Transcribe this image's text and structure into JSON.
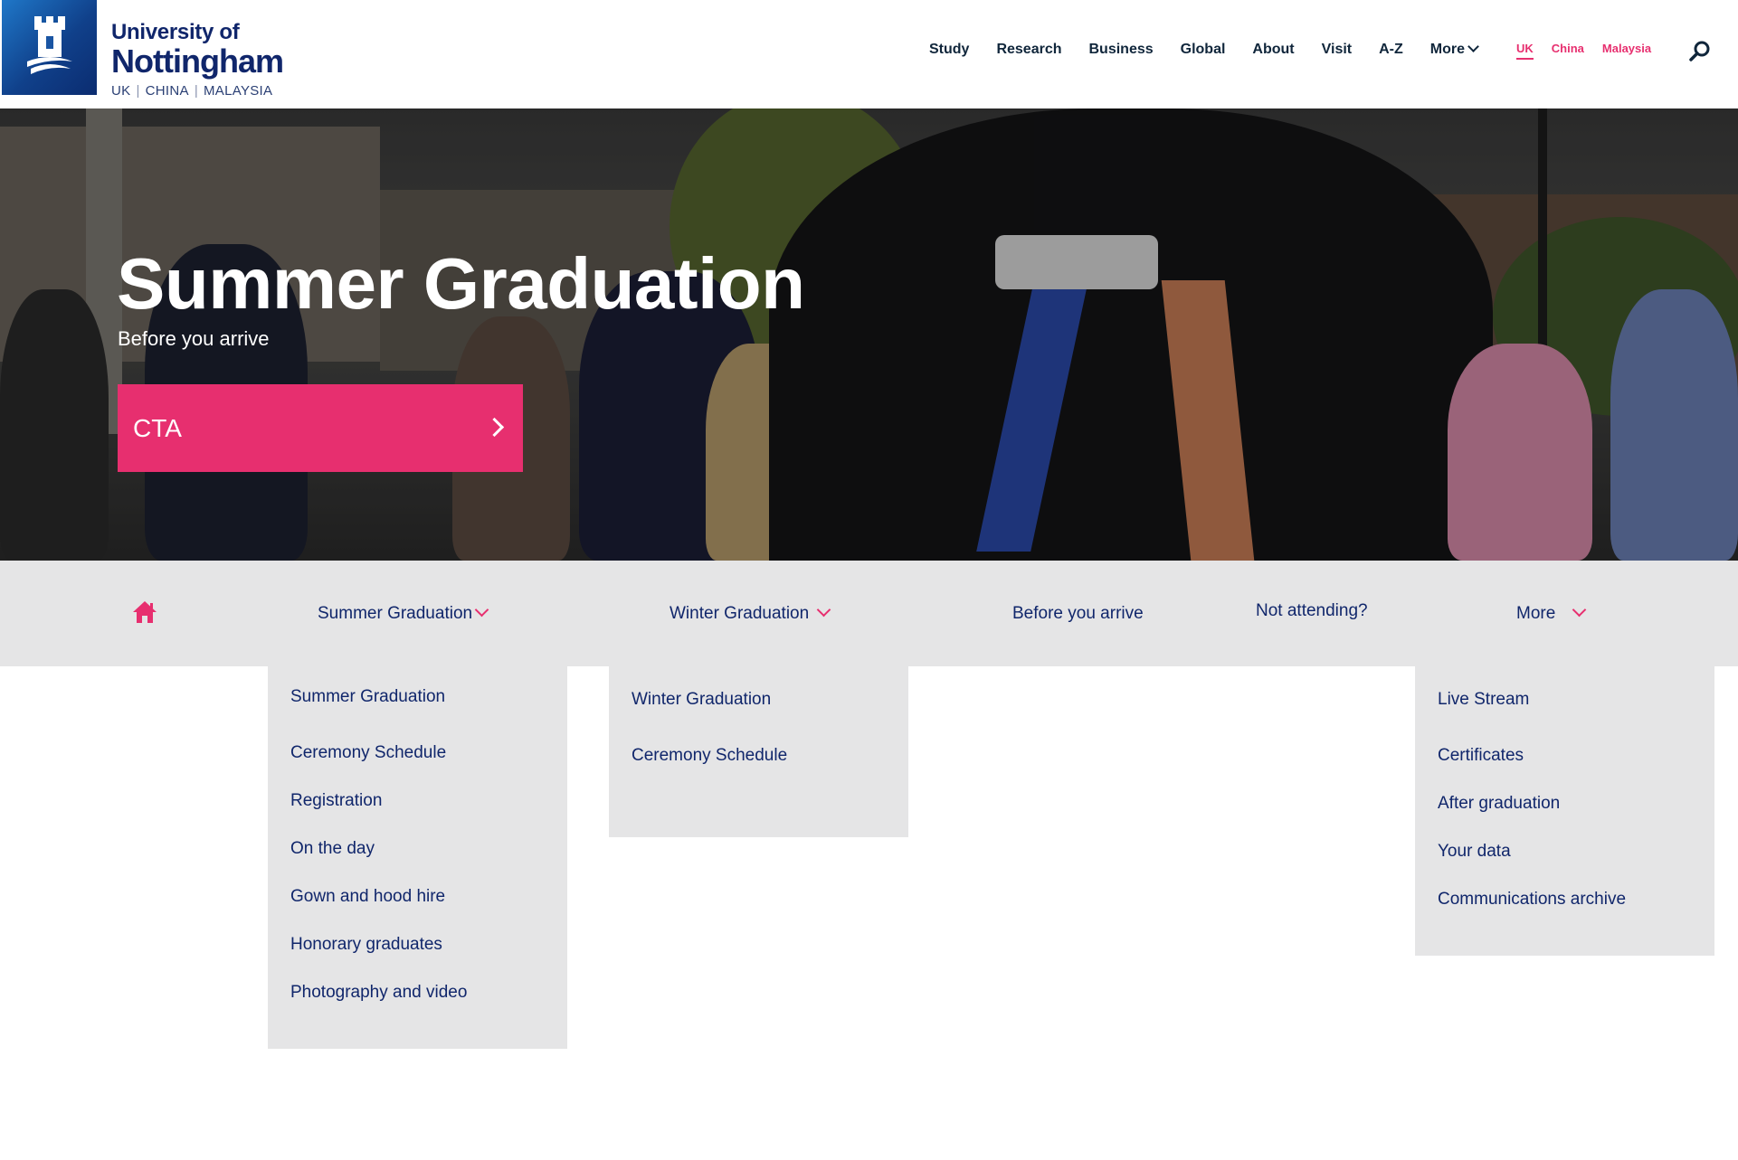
{
  "brand": {
    "line1": "University of",
    "line2": "Nottingham",
    "campus_uk": "UK",
    "campus_china": "CHINA",
    "campus_malaysia": "MALAYSIA"
  },
  "topnav": {
    "items": [
      "Study",
      "Research",
      "Business",
      "Global",
      "About",
      "Visit",
      "A-Z"
    ],
    "more_label": "More"
  },
  "campus_switch": {
    "items": [
      "UK",
      "China",
      "Malaysia"
    ],
    "active": "UK"
  },
  "hero": {
    "title": "Summer Graduation",
    "subtitle": "Before you arrive",
    "cta_label": "CTA"
  },
  "secnav": {
    "items": [
      "Summer Graduation",
      "Winter Graduation",
      "Before you arrive",
      "Not attending?",
      "More"
    ]
  },
  "dropdowns": {
    "summer": [
      "Summer Graduation",
      "Ceremony Schedule",
      "Registration",
      "On the day",
      "Gown and hood hire",
      "Honorary graduates",
      "Photography and video"
    ],
    "winter": [
      "Winter Graduation",
      "Ceremony Schedule"
    ],
    "more": [
      "Live Stream",
      "Certificates",
      "After graduation",
      "Your data",
      "Communications archive"
    ]
  },
  "colors": {
    "accent_pink": "#e72f6f",
    "navy": "#10266b",
    "nav_grey": "#e5e5e6",
    "brand_blue": "#10408a"
  },
  "icons": [
    "castle-crest-icon",
    "chevron-down-icon",
    "search-icon",
    "home-icon",
    "chevron-right-icon"
  ]
}
